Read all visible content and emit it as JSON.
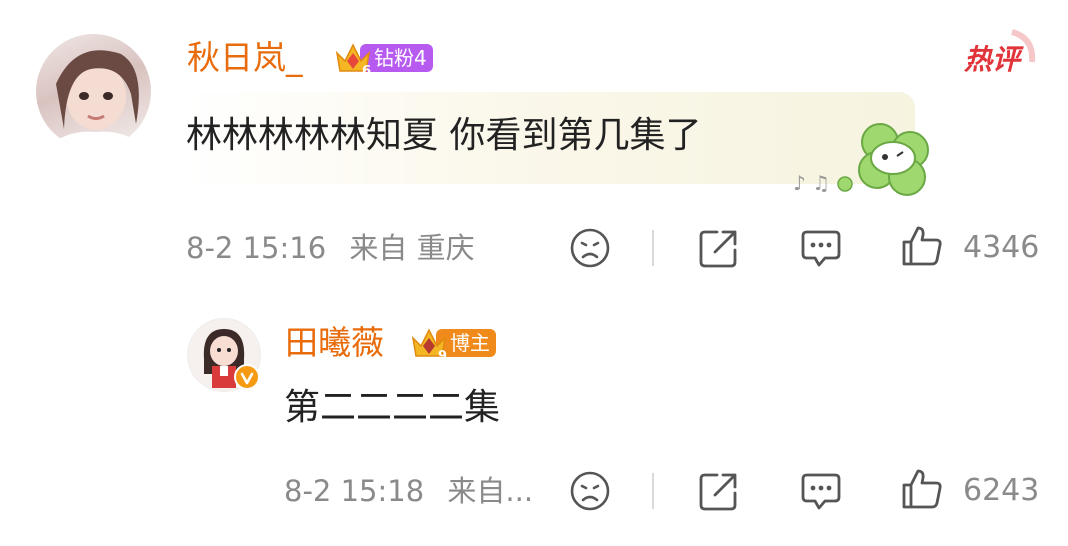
{
  "hot_label": "热评",
  "comment": {
    "username": "秋日岚_",
    "badge_level": "6",
    "badge_text": "钻粉4",
    "text": "林林林林林知夏 你看到第几集了",
    "time": "8-2 15:16",
    "location": "来自 重庆",
    "likes": "4346"
  },
  "reply": {
    "username": "田曦薇",
    "badge_level": "9",
    "badge_text": "博主",
    "text": "第二二二二集",
    "time": "8-2 15:18",
    "location": "来自...",
    "likes": "6243"
  },
  "colors": {
    "username": "#e86b0c",
    "hot_label": "#e0343a",
    "badge_fan": "#b65af0",
    "badge_blogger": "#f08a1a",
    "meta": "#8a8a8a"
  }
}
